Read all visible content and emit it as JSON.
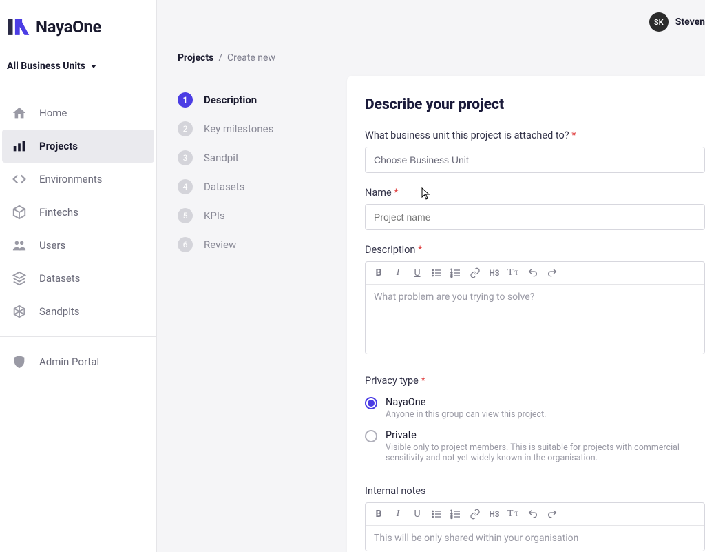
{
  "brand": {
    "name": "NayaOne"
  },
  "user": {
    "initials": "SK",
    "name": "Steven"
  },
  "bu_selector": {
    "label": "All Business Units"
  },
  "sidebar": {
    "items": [
      {
        "label": "Home",
        "icon": "home-icon",
        "active": false
      },
      {
        "label": "Projects",
        "icon": "projects-icon",
        "active": true
      },
      {
        "label": "Environments",
        "icon": "code-icon",
        "active": false
      },
      {
        "label": "Fintechs",
        "icon": "cube-icon",
        "active": false
      },
      {
        "label": "Users",
        "icon": "users-icon",
        "active": false
      },
      {
        "label": "Datasets",
        "icon": "layers-icon",
        "active": false
      },
      {
        "label": "Sandpits",
        "icon": "sandpit-icon",
        "active": false
      }
    ],
    "admin_label": "Admin Portal"
  },
  "breadcrumb": {
    "root": "Projects",
    "sep": "/",
    "leaf": "Create new"
  },
  "steps": [
    {
      "num": "1",
      "label": "Description",
      "active": true
    },
    {
      "num": "2",
      "label": "Key milestones",
      "active": false
    },
    {
      "num": "3",
      "label": "Sandpit",
      "active": false
    },
    {
      "num": "4",
      "label": "Datasets",
      "active": false
    },
    {
      "num": "5",
      "label": "KPIs",
      "active": false
    },
    {
      "num": "6",
      "label": "Review",
      "active": false
    }
  ],
  "form": {
    "title": "Describe your project",
    "bu_label": "What business unit this project is attached to?",
    "bu_placeholder": "Choose Business Unit",
    "name_label": "Name",
    "name_placeholder": "Project name",
    "desc_label": "Description",
    "desc_placeholder": "What problem are you trying to solve?",
    "privacy_label": "Privacy type",
    "privacy": [
      {
        "label": "NayaOne",
        "desc": "Anyone in this group can view this project.",
        "selected": true
      },
      {
        "label": "Private",
        "desc": "Visible only to project members. This is suitable for projects with commercial sensitivity and not yet widely known in the organisation.",
        "selected": false
      }
    ],
    "notes_label": "Internal notes",
    "notes_placeholder": "This will be only shared within your organisation"
  },
  "rte_icons": [
    "B",
    "I",
    "U",
    "list-ul",
    "list-ol",
    "link",
    "H3",
    "Tt",
    "undo",
    "redo"
  ]
}
